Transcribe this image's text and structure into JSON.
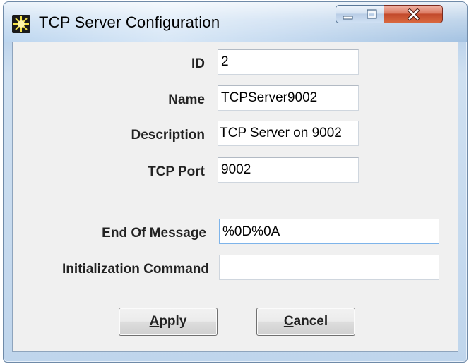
{
  "window": {
    "title": "TCP Server Configuration",
    "controls": {
      "minimize": "minimize-icon",
      "maximize": "maximize-icon",
      "close": "close-icon"
    },
    "app_icon": "starburst-icon"
  },
  "form": {
    "id": {
      "label": "ID",
      "value": "2"
    },
    "name": {
      "label": "Name",
      "value": "TCPServer9002"
    },
    "description": {
      "label": "Description",
      "value": "TCP Server on 9002"
    },
    "tcp_port": {
      "label": "TCP Port",
      "value": "9002"
    },
    "end_of_message": {
      "label": "End Of Message",
      "value": "%0D%0A"
    },
    "init_command": {
      "label": "Initialization Command",
      "value": ""
    }
  },
  "buttons": {
    "apply": {
      "mnemonic": "A",
      "rest": "pply"
    },
    "cancel": {
      "mnemonic": "C",
      "rest": "ancel"
    }
  },
  "colors": {
    "client_bg": "#f0f0f0",
    "close_button": "#c24a2c",
    "focus_border": "#7eb4ea"
  }
}
